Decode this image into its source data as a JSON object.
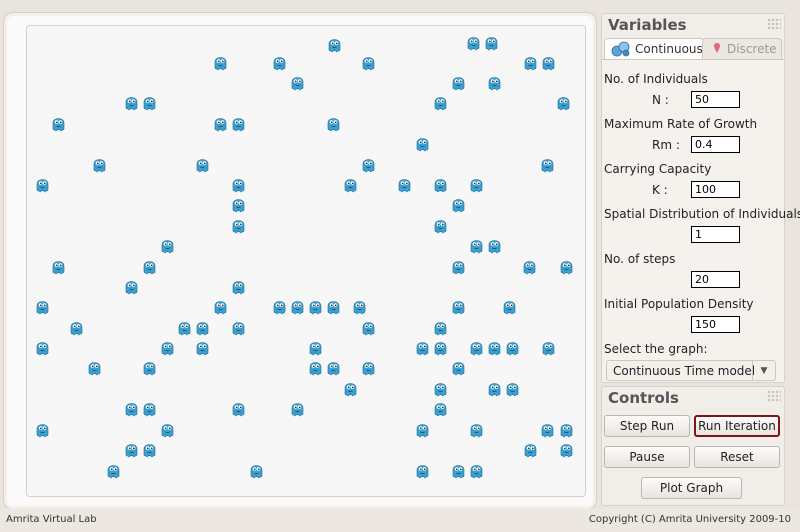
{
  "variables": {
    "title": "Variables",
    "tabs": [
      {
        "label": "Continuous",
        "icon": "bubbles-icon",
        "active": true
      },
      {
        "label": "Discrete",
        "icon": "marker-icon",
        "active": false
      }
    ],
    "fields": [
      {
        "label": "No. of Individuals",
        "symbol": "N :",
        "value": "50"
      },
      {
        "label": "Maximum Rate of Growth",
        "symbol": "Rm :",
        "value": "0.4"
      },
      {
        "label": "Carrying Capacity",
        "symbol": "K :",
        "value": "100"
      },
      {
        "label": "Spatial Distribution of Individuals",
        "symbol": "",
        "value": "1"
      },
      {
        "label": "No. of steps",
        "symbol": "",
        "value": "20"
      },
      {
        "label": "Initial Population Density",
        "symbol": "",
        "value": "150"
      }
    ],
    "graph_label": "Select the graph:",
    "graph_selected": "Continuous Time model"
  },
  "controls": {
    "title": "Controls",
    "step_run": "Step Run",
    "run_iteration": "Run Iteration",
    "pause": "Pause",
    "reset": "Reset",
    "plot_graph": "Plot Graph"
  },
  "footer": {
    "left": "Amrita Virtual Lab",
    "right": "Copyright (C) Amrita University 2009-10"
  },
  "colors": {
    "organism": "#3a9fd1",
    "focus_border": "#7a1717"
  }
}
